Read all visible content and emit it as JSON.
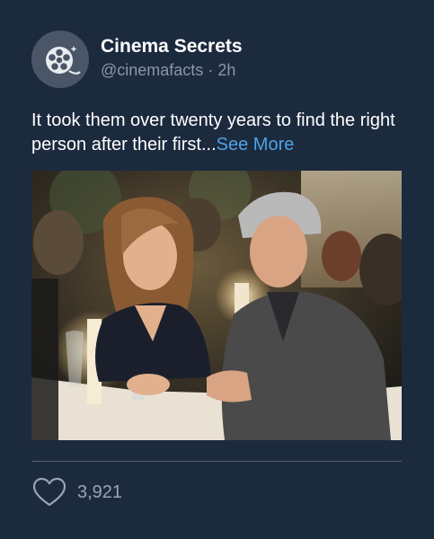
{
  "post": {
    "author_name": "Cinema Secrets",
    "author_handle": "@cinemafacts",
    "separator": "·",
    "time_ago": "2h",
    "text": "It took them over twenty years to find the right person after their first...",
    "see_more_label": "See More",
    "image_icon": "photo-of-couple-dining-by-candlelight",
    "avatar_icon": "film-reel-icon",
    "like_icon": "heart-outline-icon",
    "like_count": "3,921"
  },
  "colors": {
    "background": "#1c2a3e",
    "primary_text": "#ffffff",
    "secondary_text": "#8b96a6",
    "link": "#4ea3e6",
    "divider": "#566275",
    "avatar_bg": "#4a5568"
  }
}
